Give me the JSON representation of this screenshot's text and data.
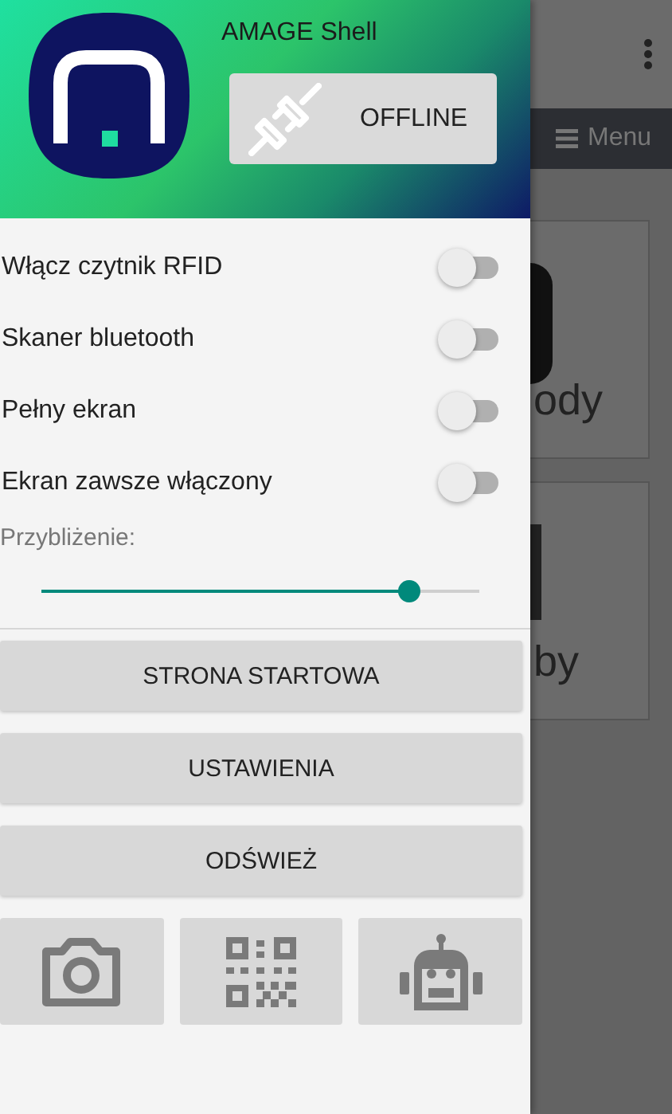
{
  "drawer": {
    "app_title": "AMAGE Shell",
    "connection_button": {
      "label": "OFFLINE"
    },
    "toggles": [
      {
        "label": "Włącz czytnik RFID",
        "on": false
      },
      {
        "label": "Skaner bluetooth",
        "on": false
      },
      {
        "label": "Pełny ekran",
        "on": false
      },
      {
        "label": "Ekran zawsze włączony",
        "on": false
      }
    ],
    "zoom": {
      "label": "Przybliżenie:",
      "level": 0.84
    },
    "buttons": [
      "STRONA STARTOWA",
      "USTAWIENIA",
      "ODŚWIEŻ"
    ],
    "icon_buttons": [
      {
        "kind": "camera"
      },
      {
        "kind": "qr"
      },
      {
        "kind": "robot"
      }
    ]
  },
  "background_app": {
    "menu_button": "Menu",
    "cards": [
      "ody",
      "by"
    ]
  }
}
